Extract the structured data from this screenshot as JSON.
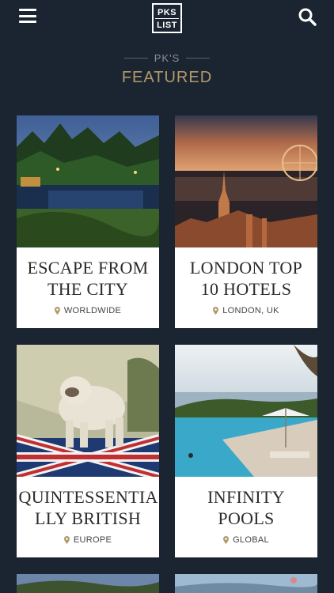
{
  "header": {
    "logo_line1": "PKS",
    "logo_line2": "LIST",
    "menu_icon": "hamburger-icon",
    "search_icon": "search-icon"
  },
  "section": {
    "subtitle": "PK'S",
    "title": "FEATURED"
  },
  "cards": [
    {
      "title": "ESCAPE FROM THE CITY",
      "location": "WORLDWIDE"
    },
    {
      "title": "LONDON TOP 10 HOTELS",
      "location": "LONDON, UK"
    },
    {
      "title": "QUINTESSENTIA LLY BRITISH",
      "location": "EUROPE"
    },
    {
      "title": "INFINITY POOLS",
      "location": "GLOBAL"
    }
  ],
  "colors": {
    "background": "#1b2431",
    "accent_gold": "#b49a6a",
    "pin": "#b49a6a"
  }
}
